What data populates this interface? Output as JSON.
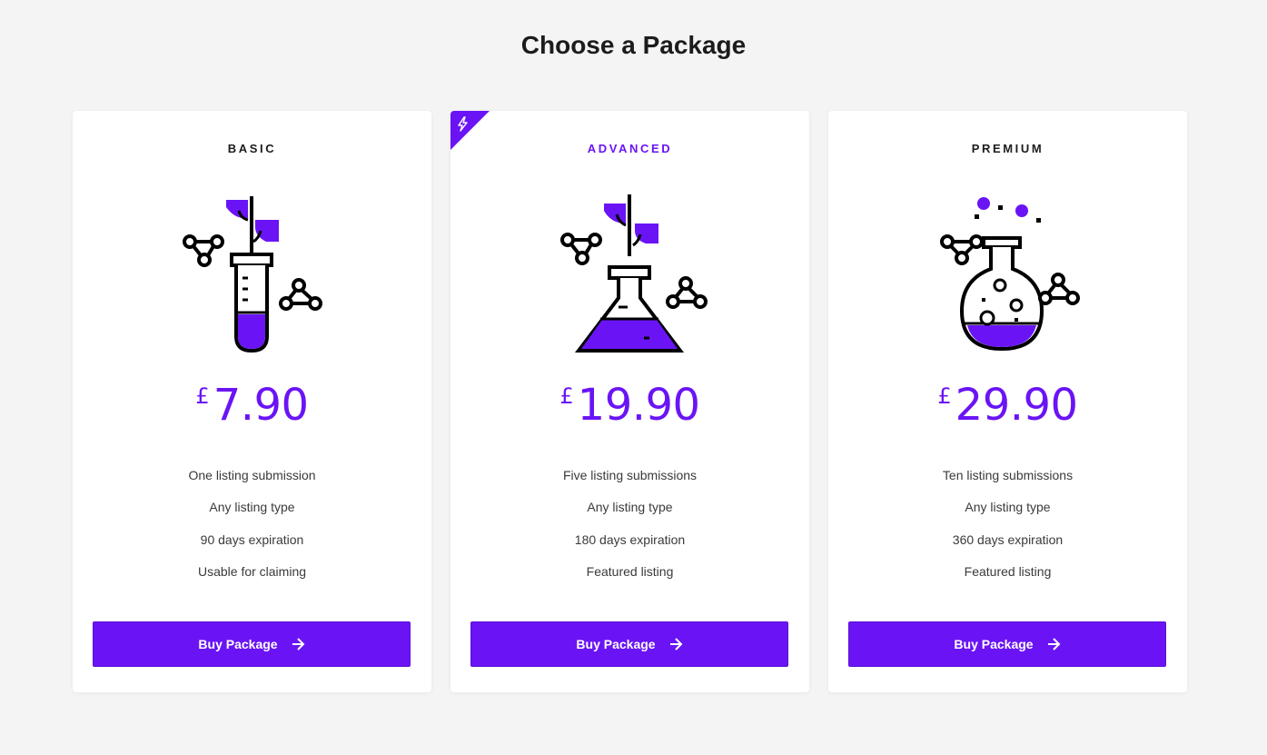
{
  "page": {
    "title": "Choose a Package"
  },
  "colors": {
    "accent": "#6a14f5",
    "text": "#1c1c1c",
    "background": "#f4f4f4",
    "card": "#ffffff"
  },
  "packages": [
    {
      "name": "BASIC",
      "currency": "£",
      "price": "7.90",
      "illustration": "test-tube-plant-icon",
      "features": [
        "One listing submission",
        "Any listing type",
        "90 days expiration",
        "Usable for claiming"
      ],
      "button_label": "Buy Package"
    },
    {
      "name": "ADVANCED",
      "featured_badge_icon": "lightning-icon",
      "currency": "£",
      "price": "19.90",
      "illustration": "flask-plant-icon",
      "features": [
        "Five listing submissions",
        "Any listing type",
        "180 days expiration",
        "Featured listing"
      ],
      "button_label": "Buy Package"
    },
    {
      "name": "PREMIUM",
      "currency": "£",
      "price": "29.90",
      "illustration": "round-flask-bubbles-icon",
      "features": [
        "Ten listing submissions",
        "Any listing type",
        "360 days expiration",
        "Featured listing"
      ],
      "button_label": "Buy Package"
    }
  ]
}
